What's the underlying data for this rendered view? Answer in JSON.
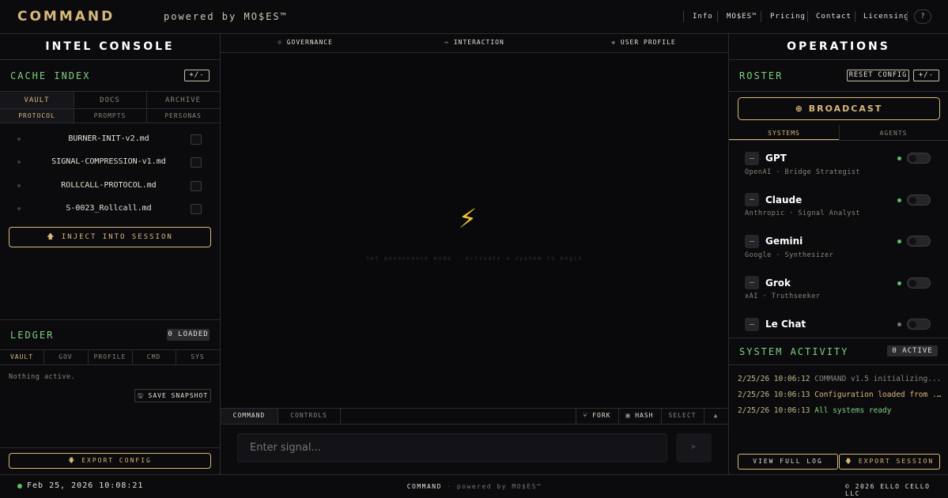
{
  "header": {
    "logo": "COMMAND",
    "powered": "powered by MO$ES™",
    "nav": [
      "Info",
      "MO$ES™",
      "Pricing",
      "Contact",
      "Licensing"
    ],
    "help": "?"
  },
  "left": {
    "title": "INTEL CONSOLE",
    "cache": {
      "title": "CACHE INDEX",
      "toggle": "+/-",
      "tabs": [
        "VAULT",
        "DOCS",
        "ARCHIVE"
      ],
      "subtabs": [
        "PROTOCOL",
        "PROMPTS",
        "PERSONAS"
      ],
      "files": [
        "BURNER-INIT-v2.md",
        "SIGNAL-COMPRESSION-v1.md",
        "ROLLCALL-PROTOCOL.md",
        "S-0023_Rollcall.md"
      ],
      "inject": "INJECT INTO SESSION"
    },
    "ledger": {
      "title": "LEDGER",
      "badge": "0 LOADED",
      "tabs": [
        "VAULT",
        "GOV",
        "PROFILE",
        "CMD",
        "SYS"
      ],
      "empty": "Nothing active.",
      "snapshot": "SAVE SNAPSHOT"
    },
    "export": "EXPORT CONFIG"
  },
  "center": {
    "tabs": [
      "GOVERNANCE",
      "INTERACTION",
      "USER PROFILE"
    ],
    "tab_icons": [
      "⊙",
      "↔",
      "◈"
    ],
    "bolt": "⚡",
    "hint": "Set governance mode · activate a system to begin",
    "bottom_tabs": [
      "COMMAND",
      "CONTROLS"
    ],
    "fork": "FORK",
    "hash": "HASH",
    "select": "SELECT",
    "caret": "▲",
    "input_placeholder": "Enter signal...",
    "send": "➤"
  },
  "right": {
    "title": "OPERATIONS",
    "roster": {
      "title": "ROSTER",
      "reset": "RESET CONFIG",
      "toggle": "+/-",
      "broadcast": "⊕ BROADCAST",
      "tabs": [
        "SYSTEMS",
        "AGENTS"
      ],
      "agents": [
        {
          "name": "GPT",
          "sub": "OpenAI · Bridge Strategist",
          "status": "#5fc05f"
        },
        {
          "name": "Claude",
          "sub": "Anthropic · Signal Analyst",
          "status": "#5fc05f"
        },
        {
          "name": "Gemini",
          "sub": "Google · Synthesizer",
          "status": "#5fc05f"
        },
        {
          "name": "Grok",
          "sub": "xAI · Truthseeker",
          "status": "#5fc05f"
        },
        {
          "name": "Le Chat",
          "sub": "",
          "status": "#777777"
        }
      ]
    },
    "activity": {
      "title": "SYSTEM ACTIVITY",
      "badge": "0 ACTIVE",
      "logs": [
        {
          "time": "2/25/26 10:06:12",
          "text": "COMMAND v1.5 initializing...",
          "color": "#8a8578"
        },
        {
          "time": "2/25/26 10:06:13",
          "text": "Configuration loaded from ...",
          "color": "#d9b87a"
        },
        {
          "time": "2/25/26 10:06:13",
          "text": "All systems ready",
          "color": "#7fd07f"
        }
      ],
      "view_log": "VIEW FULL LOG",
      "export": "EXPORT SESSION"
    }
  },
  "footer": {
    "clock": "Feb 25, 2026 10:08:21",
    "center_brand": "COMMAND",
    "center_sep": "·",
    "center_powered": "powered by MO$ES™",
    "copyright": "© 2026 ELLO CELLO LLC"
  }
}
